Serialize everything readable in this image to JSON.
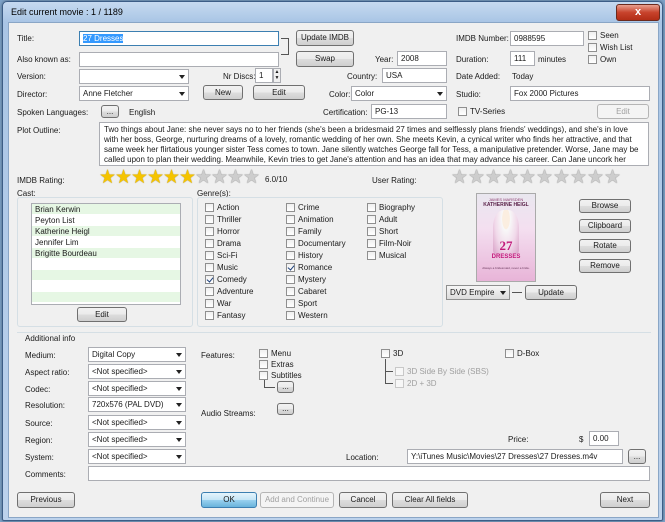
{
  "window": {
    "title": "Edit current movie : 1 / 1189",
    "close": "x"
  },
  "labels": {
    "title": "Title:",
    "also_known_as": "Also known as:",
    "version": "Version:",
    "nr_discs": "Nr Discs:",
    "director": "Director:",
    "spoken_languages": "Spoken Languages:",
    "year": "Year:",
    "country": "Country:",
    "color": "Color:",
    "certification": "Certification:",
    "imdb_number": "IMDB Number:",
    "duration": "Duration:",
    "minutes": "minutes",
    "date_added": "Date Added:",
    "studio": "Studio:",
    "plot_outline": "Plot Outline:",
    "imdb_rating": "IMDB Rating:",
    "user_rating": "User Rating:",
    "cast": "Cast:",
    "genres": "Genre(s):",
    "additional_info": "Additional info",
    "medium": "Medium:",
    "aspect_ratio": "Aspect ratio:",
    "codec": "Codec:",
    "resolution": "Resolution:",
    "source": "Source:",
    "region": "Region:",
    "system": "System:",
    "comments": "Comments:",
    "features": "Features:",
    "audio_streams": "Audio Streams:",
    "location": "Location:",
    "price": "Price:",
    "currency": "$"
  },
  "fields": {
    "title": "27 Dresses",
    "also_known_as": "",
    "version": "",
    "nr_discs": "1",
    "director": "Anne Fletcher",
    "spoken_languages": "English",
    "year": "2008",
    "country": "USA",
    "color": "Color",
    "certification": "PG-13",
    "imdb_number": "0988595",
    "duration": "111",
    "date_added": "Today",
    "studio": "Fox 2000 Pictures",
    "plot": "Two things about Jane: she never says no to her friends (she's been a bridesmaid 27 times and selflessly plans friends' weddings), and she's in love with her boss, George, nurturing dreams of a lovely, romantic wedding of her own. She meets Kevin, a cynical writer who finds her attractive, and that same week her flirtatious younger sister Tess comes to town. Jane silently watches George fall for Tess, a manipulative pretender. Worse, Jane may be called upon to plan their wedding. Meanwhile, Kevin tries to get Jane's attention and has an idea that may advance his career. Can Jane uncork her feelings?",
    "imdb_rating_text": "6.0/10",
    "medium": "Digital Copy",
    "aspect_ratio": "<Not specified>",
    "codec": "<Not specified>",
    "resolution": "720x576 (PAL DVD)",
    "source": "<Not specified>",
    "region": "<Not specified>",
    "system": "<Not specified>",
    "comments": "",
    "location": "Y:\\iTunes Music\\Movies\\27 Dresses\\27 Dresses.m4v",
    "price": "0.00",
    "poster_source": "DVD Empire"
  },
  "ratings": {
    "imdb": 6,
    "user": 0,
    "max": 10
  },
  "checkboxes": {
    "seen": {
      "label": "Seen",
      "checked": false
    },
    "wish_list": {
      "label": "Wish List",
      "checked": false
    },
    "own": {
      "label": "Own",
      "checked": false
    },
    "tv_series": {
      "label": "TV-Series",
      "checked": false
    }
  },
  "buttons": {
    "update_imdb": "Update IMDB",
    "swap": "Swap",
    "new": "New",
    "edit_director": "Edit",
    "ellipsis": "...",
    "edit_studio": "Edit",
    "edit_cast": "Edit",
    "browse": "Browse",
    "clipboard": "Clipboard",
    "rotate": "Rotate",
    "remove": "Remove",
    "update_poster": "Update",
    "previous": "Previous",
    "ok": "OK",
    "add_continue": "Add and Continue",
    "cancel": "Cancel",
    "clear_all": "Clear All fields",
    "next": "Next"
  },
  "cast": [
    "Brian Kerwin",
    "Peyton List",
    "Katherine Heigl",
    "Jennifer Lim",
    "Brigitte Bourdeau",
    "",
    "",
    "",
    ""
  ],
  "genres": [
    [
      {
        "label": "Action",
        "checked": false
      },
      {
        "label": "Thriller",
        "checked": false
      },
      {
        "label": "Horror",
        "checked": false
      },
      {
        "label": "Drama",
        "checked": false
      },
      {
        "label": "Sci-Fi",
        "checked": false
      },
      {
        "label": "Music",
        "checked": false
      },
      {
        "label": "Comedy",
        "checked": true
      },
      {
        "label": "Adventure",
        "checked": false
      },
      {
        "label": "War",
        "checked": false
      },
      {
        "label": "Fantasy",
        "checked": false
      }
    ],
    [
      {
        "label": "Crime",
        "checked": false
      },
      {
        "label": "Animation",
        "checked": false
      },
      {
        "label": "Family",
        "checked": false
      },
      {
        "label": "Documentary",
        "checked": false
      },
      {
        "label": "History",
        "checked": false
      },
      {
        "label": "Romance",
        "checked": true
      },
      {
        "label": "Mystery",
        "checked": false
      },
      {
        "label": "Cabaret",
        "checked": false
      },
      {
        "label": "Sport",
        "checked": false
      },
      {
        "label": "Western",
        "checked": false
      }
    ],
    [
      {
        "label": "Biography",
        "checked": false
      },
      {
        "label": "Adult",
        "checked": false
      },
      {
        "label": "Short",
        "checked": false
      },
      {
        "label": "Film-Noir",
        "checked": false
      },
      {
        "label": "Musical",
        "checked": false
      }
    ]
  ],
  "features": {
    "menu": "Menu",
    "extras": "Extras",
    "subtitles": "Subtitles",
    "three_d": "3D",
    "sbs": "3D Side By Side (SBS)",
    "two_plus_three": "2D + 3D",
    "dbox": "D-Box"
  },
  "poster": {
    "tagline": "JAMES MARSDEN",
    "heading": "KATHERINE HEIGL",
    "big_title": "27",
    "sub_title": "DRESSES",
    "caption": "Always a bridesmaid, never a bride."
  }
}
